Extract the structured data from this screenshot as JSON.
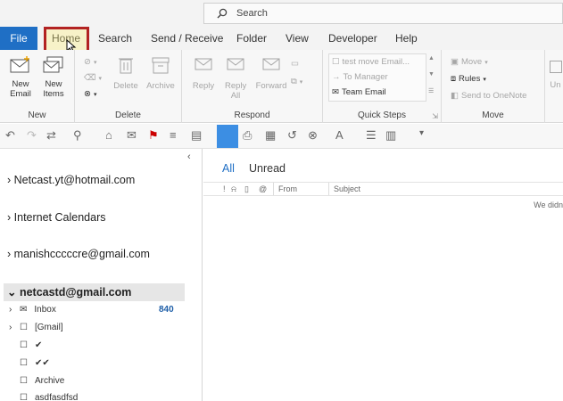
{
  "search": {
    "placeholder": "Search"
  },
  "tabs": [
    "File",
    "Home",
    "Search",
    "Send / Receive",
    "Folder",
    "View",
    "Developer",
    "Help"
  ],
  "ribbon": {
    "new_group": {
      "label": "New",
      "new_email": "New Email",
      "new_items": "New Items"
    },
    "delete_group": {
      "label": "Delete",
      "delete": "Delete",
      "archive": "Archive"
    },
    "respond_group": {
      "label": "Respond",
      "reply": "Reply",
      "reply_all": "Reply All",
      "forward": "Forward"
    },
    "quick_steps": {
      "label": "Quick Steps",
      "items": [
        "test move Email...",
        "To Manager",
        "Team Email"
      ]
    },
    "move_group": {
      "label": "Move",
      "move": "Move",
      "rules": "Rules",
      "send_onenote": "Send to OneNote"
    },
    "overflow": "Un"
  },
  "folders": {
    "accounts": [
      "Netcast.yt@hotmail.com",
      "Internet Calendars",
      "manishcccccre@gmail.com",
      "netcastd@gmail.com"
    ],
    "items": [
      {
        "name": "Inbox",
        "count": "840"
      },
      {
        "name": "[Gmail]",
        "count": ""
      },
      {
        "name": "✔",
        "count": ""
      },
      {
        "name": "✔✔",
        "count": ""
      },
      {
        "name": "Archive",
        "count": ""
      },
      {
        "name": "asdfasdfsd",
        "count": ""
      }
    ]
  },
  "messages": {
    "filters": [
      "All",
      "Unread"
    ],
    "columns": [
      "From",
      "Subject"
    ],
    "empty_hint": "We didn"
  },
  "colors": {
    "accent": "#1f6fc5",
    "highlight_border": "#b22222",
    "count": "#1f5fa8"
  }
}
